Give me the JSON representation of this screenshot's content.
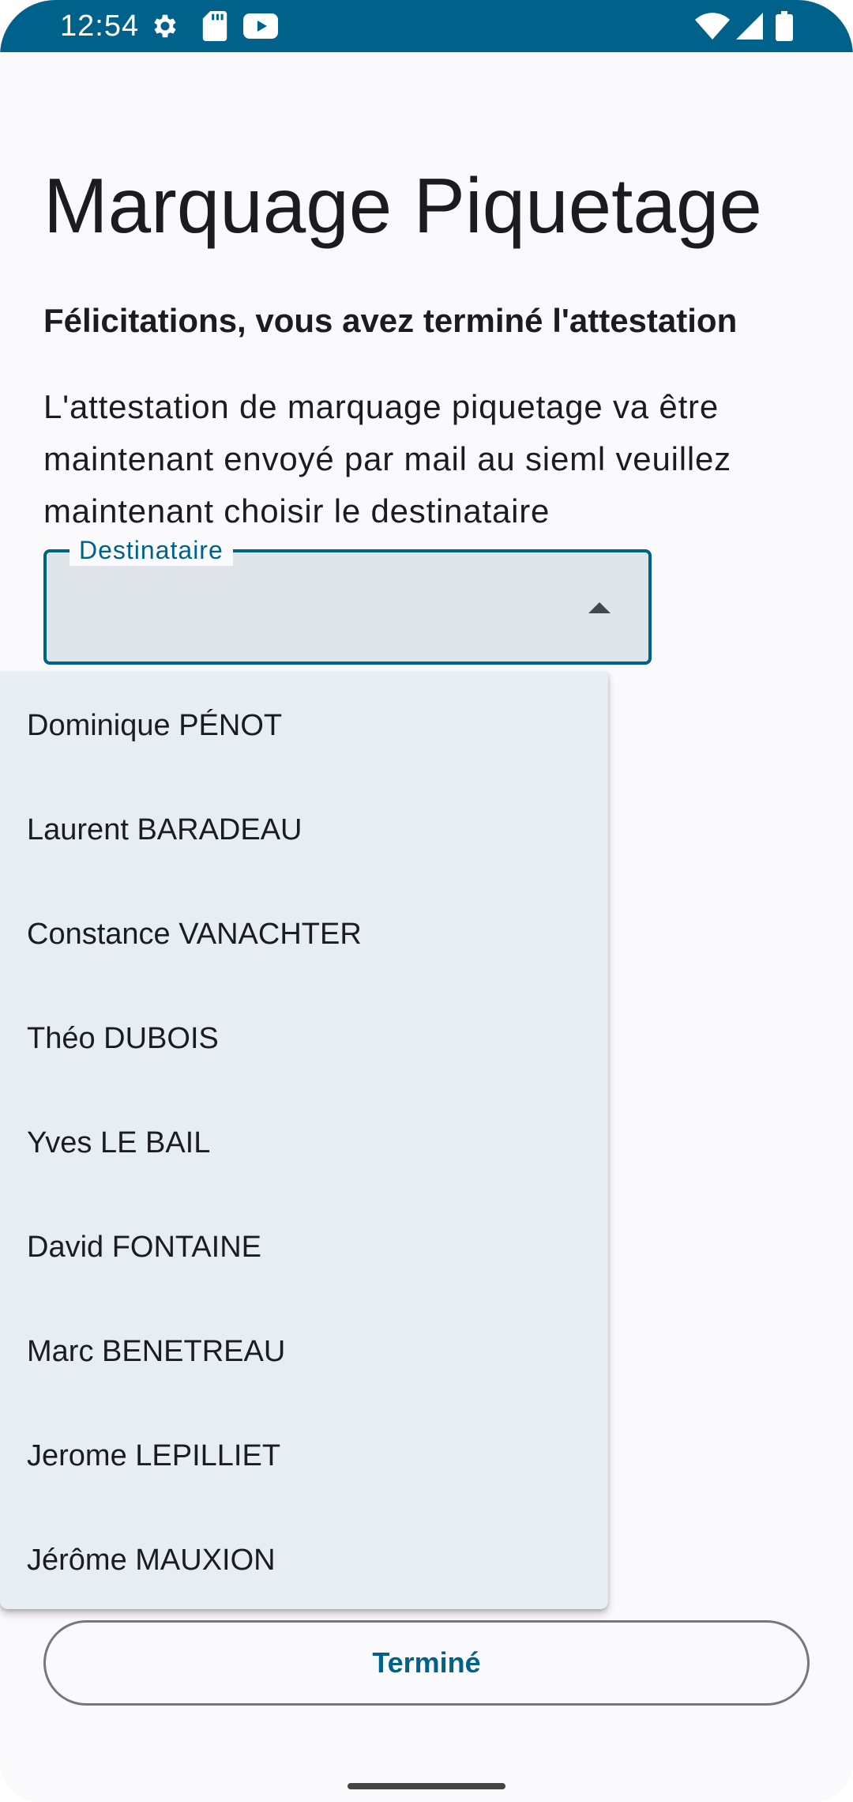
{
  "status_bar": {
    "time": "12:54",
    "icons_left": [
      "gear-icon",
      "sd-card-icon",
      "youtube-icon"
    ],
    "icons_right": [
      "wifi-icon",
      "cell-signal-icon",
      "battery-icon"
    ],
    "color": "#00628b"
  },
  "page": {
    "title": "Marquage Piquetage",
    "subtitle": "Félicitations, vous avez terminé l'attestation",
    "description": "L'attestation de marquage piquetage va être maintenant envoyé par mail au sieml veuillez maintenant choisir le destinataire"
  },
  "dropdown": {
    "label": "Destinataire",
    "value": "",
    "expanded": true,
    "options": [
      "Dominique PÉNOT",
      "Laurent BARADEAU",
      "Constance VANACHTER",
      "Théo DUBOIS",
      "Yves LE BAIL",
      "David FONTAINE",
      "Marc BENETREAU",
      "Jerome LEPILLIET",
      "Jérôme MAUXION"
    ]
  },
  "actions": {
    "done_label": "Terminé"
  },
  "colors": {
    "accent": "#00628b",
    "menu_background": "#e7eef3",
    "field_background": "#dfe3ea"
  }
}
